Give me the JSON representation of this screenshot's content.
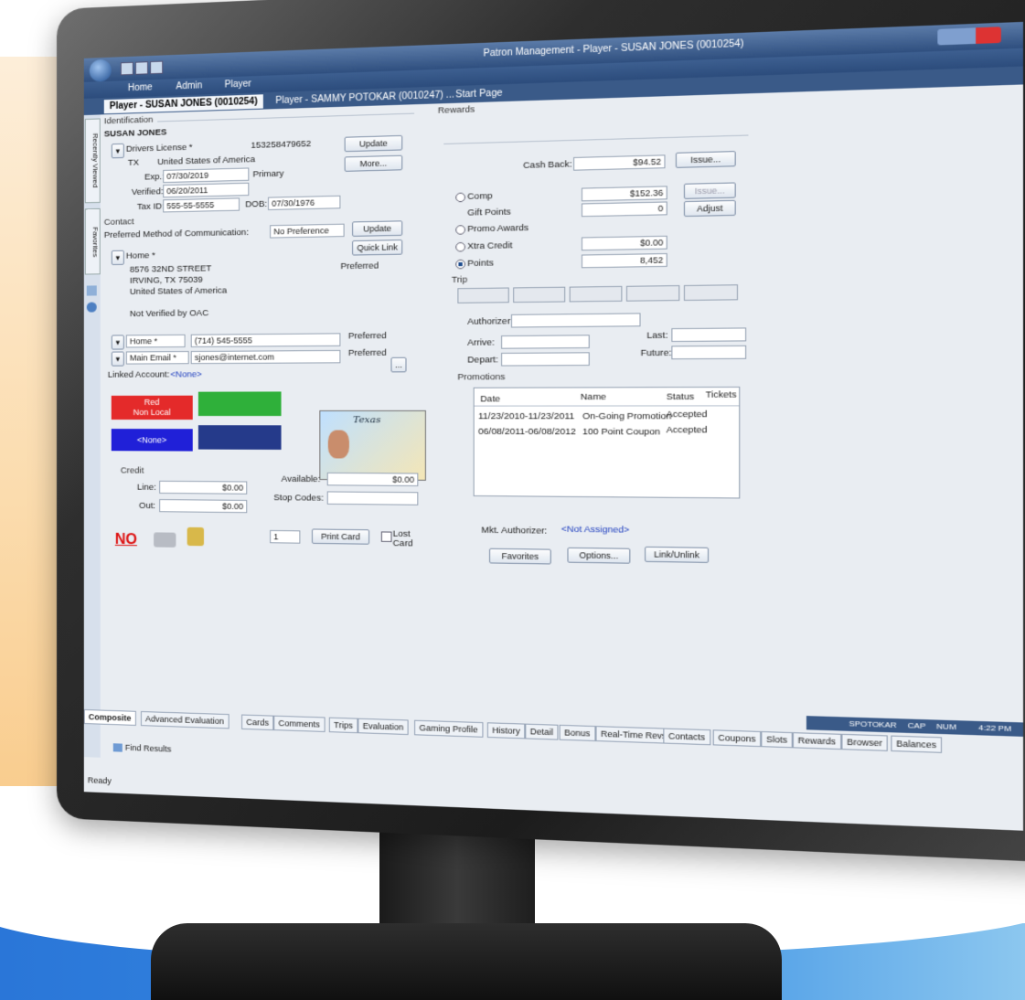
{
  "window": {
    "title": "Patron Management - Player - SUSAN JONES (0010254)",
    "menu": [
      "Home",
      "Admin",
      "Player"
    ]
  },
  "doc_tabs": [
    "Player - SUSAN JONES (0010254)",
    "Player - SAMMY POTOKAR (0010247) ...",
    "Start Page"
  ],
  "left_tabs": [
    "Recently Viewed",
    "Favorites"
  ],
  "identification": {
    "section": "Identification",
    "name": "SUSAN JONES",
    "id_type": "Drivers License *",
    "id_number": "153258479652",
    "state": "TX",
    "country": "United States of America",
    "exp_label": "Exp.:",
    "exp": "07/30/2019",
    "primary": "Primary",
    "verified_label": "Verified:",
    "verified": "06/20/2011",
    "taxid_label": "Tax ID:",
    "taxid": "555-55-5555",
    "dob_label": "DOB:",
    "dob": "07/30/1976",
    "update": "Update",
    "more": "More..."
  },
  "contact": {
    "section": "Contact",
    "pref_label": "Preferred Method of Communication:",
    "pref_value": "No Preference",
    "update": "Update",
    "quick_link": "Quick Link",
    "address_type": "Home *",
    "preferred": "Preferred",
    "address1": "8576 32ND STREET",
    "address2": "IRVING, TX  75039",
    "address3": "United States of America",
    "address4": "Not Verified by OAC",
    "phone_type": "Home *",
    "phone": "(714) 545-5555",
    "email_type": "Main Email *",
    "email": "sjones@internet.com",
    "phone_pref": "Preferred",
    "email_pref": "Preferred",
    "linked_label": "Linked Account:",
    "linked_value": "<None>",
    "ellipsis": "..."
  },
  "swatches": {
    "red_label": "Red\nNon Local",
    "blue_label": "<None>",
    "red": "#e42a2a",
    "green": "#2fb03a",
    "blue": "#2020d8",
    "navy": "#253a8a"
  },
  "idcard_text": "Texas",
  "credit": {
    "section": "Credit",
    "line_label": "Line:",
    "line": "$0.00",
    "out_label": "Out:",
    "out": "$0.00",
    "available_label": "Available:",
    "available": "$0.00",
    "stop_label": "Stop Codes:"
  },
  "bottom_left": {
    "no_icon": "NO",
    "copies": "1",
    "print_card": "Print Card",
    "lost_card": "Lost Card"
  },
  "rewards": {
    "section": "Rewards",
    "cashback_label": "Cash Back:",
    "cashback": "$94.52",
    "issue": "Issue...",
    "comp": "Comp",
    "comp_value": "$152.36",
    "issue2": "Issue...",
    "gift_points": "Gift Points",
    "gift_value": "0",
    "adjust": "Adjust",
    "promo_awards": "Promo Awards",
    "xtra_credit": "Xtra Credit",
    "xtra_value": "$0.00",
    "points": "Points",
    "points_value": "8,452"
  },
  "trip": {
    "section": "Trip",
    "authorizer": "Authorizer:",
    "arrive": "Arrive:",
    "depart": "Depart:",
    "last": "Last:",
    "future": "Future:"
  },
  "promotions": {
    "section": "Promotions",
    "headers": [
      "Date",
      "Name",
      "Status",
      "Tickets"
    ],
    "rows": [
      [
        "11/23/2010-11/23/2011",
        "On-Going Promotion",
        "Accepted",
        ""
      ],
      [
        "06/08/2011-06/08/2012",
        "100 Point Coupon",
        "Accepted",
        ""
      ]
    ]
  },
  "mkt_authorizer_label": "Mkt. Authorizer:",
  "mkt_authorizer_value": "<Not Assigned>",
  "actions": [
    "Favorites",
    "Options...",
    "Link/Unlink"
  ],
  "status": {
    "user": "SPOTOKAR",
    "caps": "CAP",
    "num": "NUM",
    "time": "4:22 PM"
  },
  "bottom_tabs": [
    "Composite",
    "Advanced Evaluation",
    "Cards",
    "Comments",
    "Trips",
    "Evaluation",
    "Gaming Profile",
    "History",
    "Detail",
    "Bonus",
    "Real-Time Revs",
    "Contacts",
    "Coupons",
    "Slots",
    "Rewards",
    "Browser",
    "Balances"
  ],
  "find_results": "Find Results",
  "ready": "Ready",
  "side_letter": "i"
}
